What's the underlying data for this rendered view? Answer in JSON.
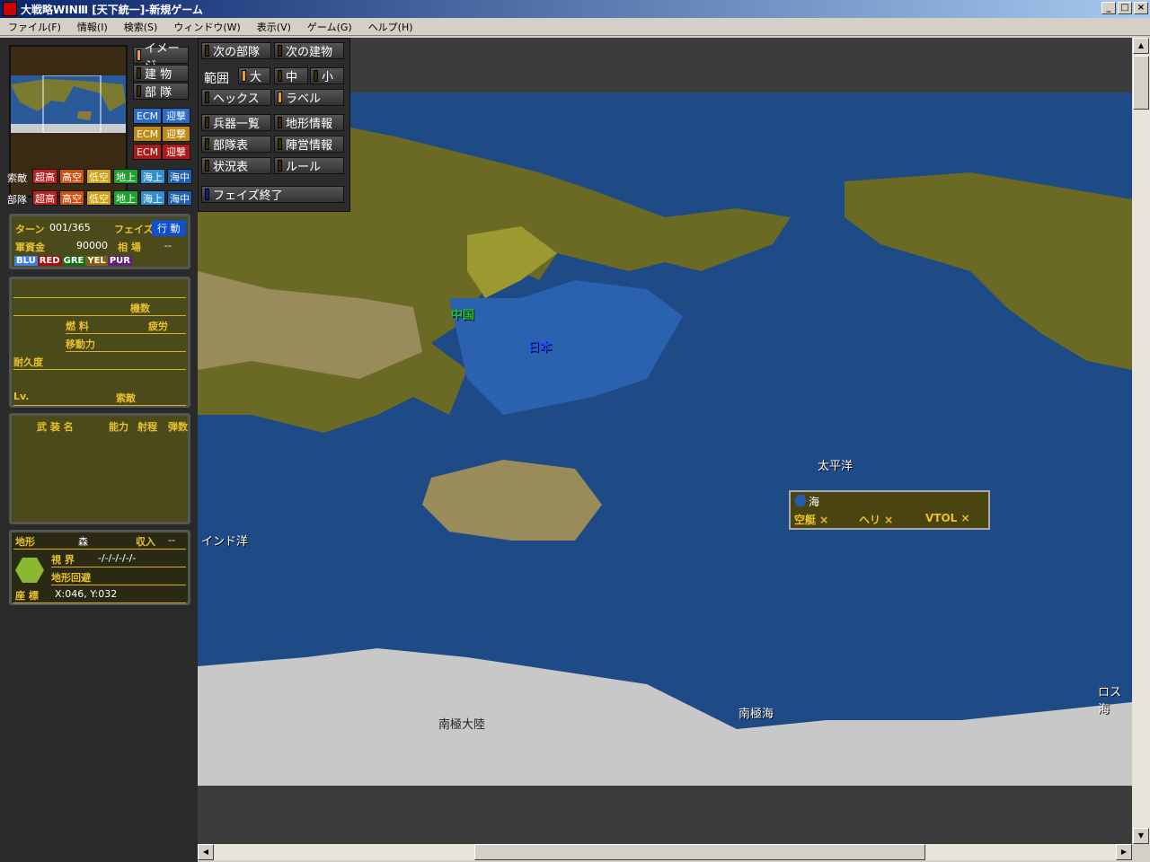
{
  "window": {
    "title": "大戦略WINⅢ [天下統一]-新規ゲーム",
    "logo": "DWII"
  },
  "menu": [
    "ファイル(F)",
    "情報(I)",
    "検索(S)",
    "ウィンドウ(W)",
    "表示(V)",
    "ゲーム(G)",
    "ヘルプ(H)"
  ],
  "view_toggles": [
    "イメージ",
    "建 物",
    "部 隊"
  ],
  "ecm_rows": [
    {
      "ecm": "ECM",
      "intercept": "迎撃",
      "color": "#2a6ac8"
    },
    {
      "ecm": "ECM",
      "intercept": "迎撃",
      "color": "#c08a10"
    },
    {
      "ecm": "ECM",
      "intercept": "迎撃",
      "color": "#b01818"
    }
  ],
  "layer_rows": [
    {
      "label": "索敵",
      "tags": [
        "超高",
        "高空",
        "低空",
        "地上",
        "海上",
        "海中"
      ]
    },
    {
      "label": "部隊",
      "tags": [
        "超高",
        "高空",
        "低空",
        "地上",
        "海上",
        "海中"
      ]
    }
  ],
  "layer_colors": [
    "#c02020",
    "#d05010",
    "#d0a010",
    "#20a030",
    "#3090d0",
    "#2060b0"
  ],
  "tools": {
    "next_unit": "次の部隊",
    "next_building": "次の建物",
    "range_label": "範囲",
    "range_large": "大",
    "range_mid": "中",
    "range_small": "小",
    "hex": "ヘックス",
    "label": "ラベル",
    "weapons": "兵器一覧",
    "terrain_info": "地形情報",
    "unit_table": "部隊表",
    "camp_info": "陣営情報",
    "status_table": "状況表",
    "rules": "ルール",
    "end_phase": "フェイズ終了"
  },
  "status": {
    "turn_label": "ターン",
    "turn": "001/365",
    "phase_label": "フェイズ",
    "phase": "行 動",
    "funds_label": "軍資金",
    "funds": "90000",
    "market_label": "相 場",
    "market": "--",
    "factions": [
      "BLU",
      "RED",
      "GRE",
      "YEL",
      "PUR"
    ],
    "faction_colors": [
      "#4080e0",
      "#a01010",
      "#107010",
      "#806010",
      "#602080"
    ]
  },
  "unit": {
    "count": "機数",
    "fuel": "燃 料",
    "fatigue": "疲労",
    "move": "移動力",
    "durability": "耐久度",
    "level": "Lv.",
    "search": "索敵"
  },
  "weapons": {
    "name": "武 装 名",
    "power": "能力",
    "range": "射程",
    "ammo": "弾数"
  },
  "terrain": {
    "label": "地形",
    "value": "森",
    "income_label": "収入",
    "income": "--",
    "vision_label": "視 界",
    "vision": "-/-/-/-/-/-",
    "evasion": "地形回避",
    "coord_label": "座 標",
    "coord": "X:046, Y:032"
  },
  "map_labels": {
    "china": "中国",
    "japan": "日本",
    "pacific": "太平洋",
    "indian": "インド洋",
    "antarctica": "南極大陸",
    "southern": "南極海",
    "la": "ロス海"
  },
  "popup": {
    "terrain": "海",
    "heli_boat": "空艇 ×",
    "heli": "ヘリ ×",
    "vtol": "VTOL ×"
  }
}
